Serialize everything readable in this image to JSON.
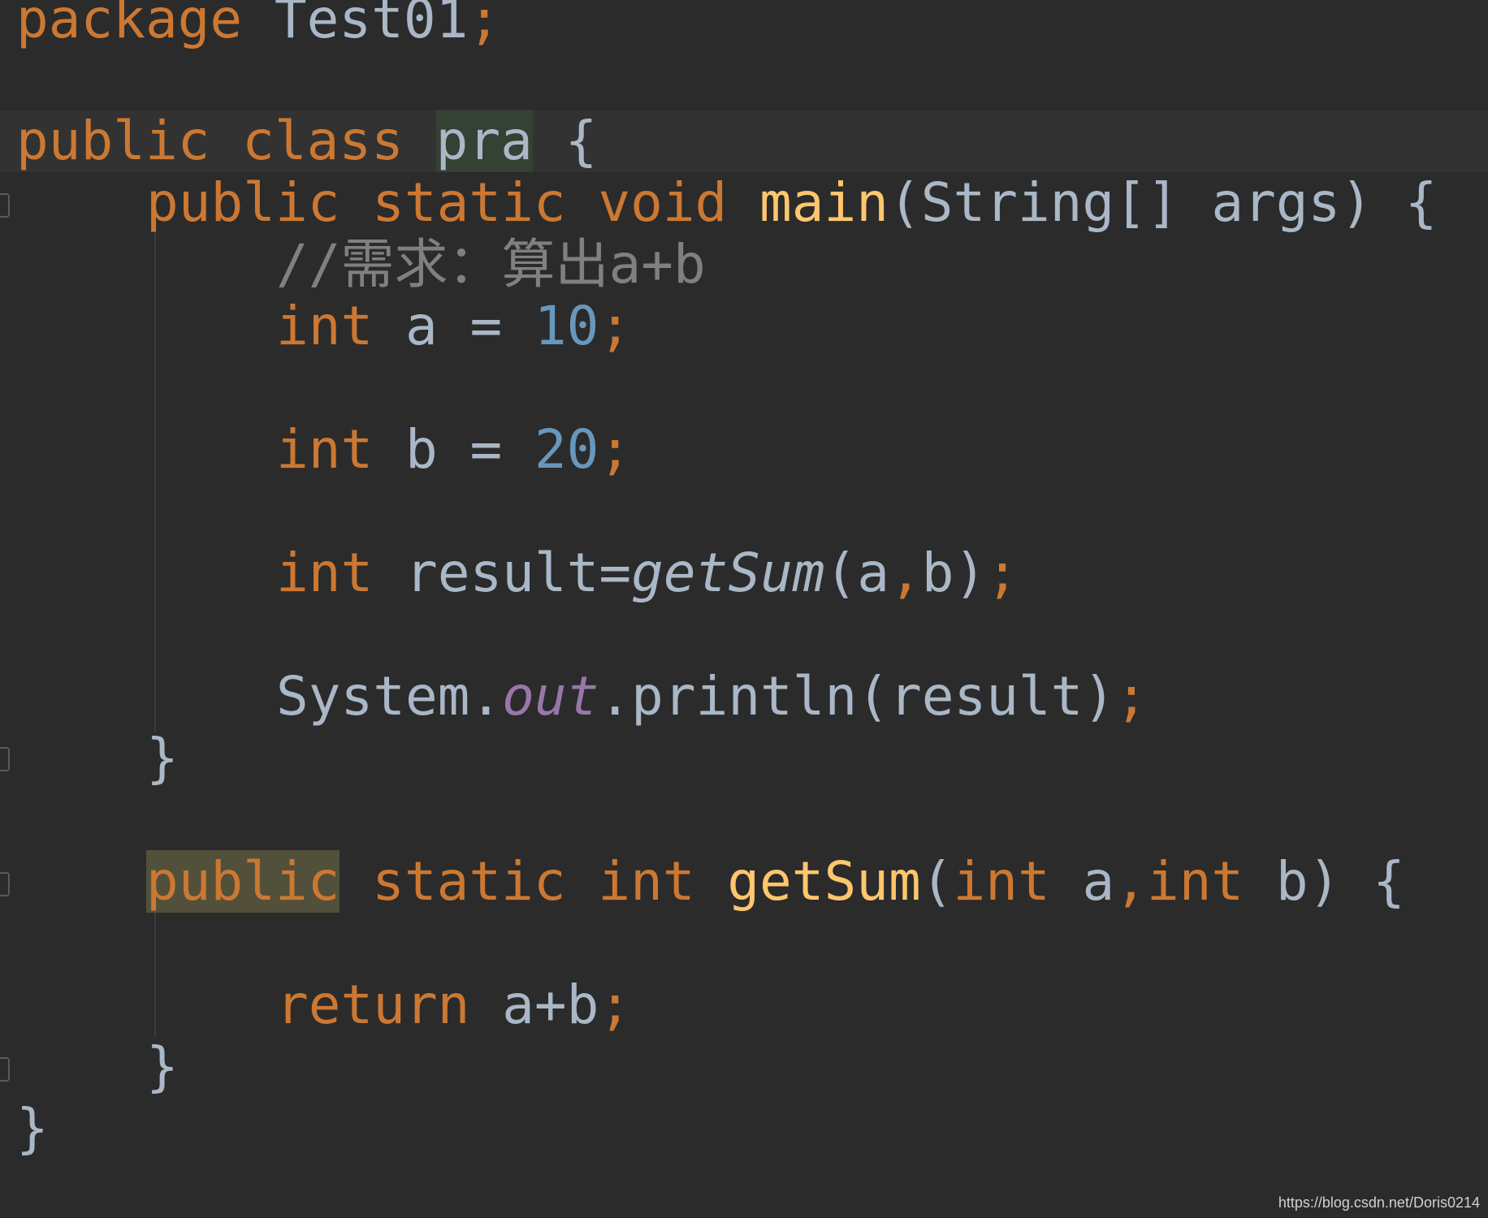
{
  "editor": {
    "lines": {
      "package_kw": "package",
      "package_name": "Test01",
      "package_semi": ";",
      "class_public": "public",
      "class_kw": "class",
      "class_name": "pra",
      "class_brace": "{",
      "main_public": "public",
      "main_static": "static",
      "main_void": "void",
      "main_name": "main",
      "main_params": "(String[] args) {",
      "comment": "//需求：算出a+b",
      "a_type": "int",
      "a_rest": "a = ",
      "a_value": "10",
      "a_semi": ";",
      "b_type": "int",
      "b_rest": "b = ",
      "b_value": "20",
      "b_semi": ";",
      "result_type": "int",
      "result_rest": "result=",
      "result_call": "getSum",
      "result_args_open": "(a",
      "result_comma": ",",
      "result_args_close": "b)",
      "result_semi": ";",
      "print_system": "System.",
      "print_out": "out",
      "print_rest": ".println(result)",
      "print_semi": ";",
      "main_close": "}",
      "sum_public": "public",
      "sum_static": "static",
      "sum_int": "int",
      "sum_name": "getSum",
      "sum_paren_open": "(",
      "sum_p1_type": "int",
      "sum_p1_name": "a",
      "sum_comma": ",",
      "sum_p2_type": "int",
      "sum_p2_rest": "b) {",
      "return_kw": "return",
      "return_expr": "a+b",
      "return_semi": ";",
      "sum_close": "}",
      "class_close": "}"
    }
  },
  "watermark": "https://blog.csdn.net/Doris0214",
  "colors": {
    "background": "#2b2b2b",
    "keyword": "#cc7832",
    "identifier": "#a9b7c6",
    "number": "#6897bb",
    "function": "#ffc66d",
    "comment": "#808080",
    "static_field": "#9876aa"
  }
}
